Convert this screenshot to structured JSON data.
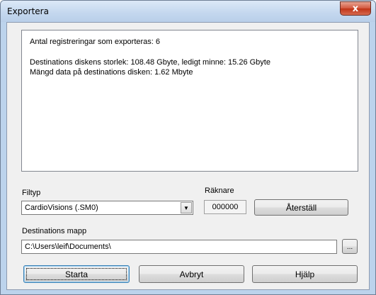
{
  "window": {
    "title": "Exportera",
    "close_label": "x"
  },
  "info": {
    "count_line": "Antal registreringar som exporteras: 6",
    "disk_line": "Destinations diskens storlek: 108.48 Gbyte, ledigt minne: 15.26 Gbyte",
    "data_line": "Mängd data på destinations disken: 1.62 Mbyte"
  },
  "filetype": {
    "label": "Filtyp",
    "selected": "CardioVisions (.SM0)",
    "arrow_icon": "chevron-down-icon"
  },
  "counter": {
    "label": "Räknare",
    "value": "000000",
    "reset_label": "Återställ"
  },
  "destination": {
    "label": "Destinations mapp",
    "value": "C:\\Users\\leif\\Documents\\",
    "browse_label": "..."
  },
  "buttons": {
    "start": "Starta",
    "cancel": "Avbryt",
    "help": "Hjälp"
  }
}
